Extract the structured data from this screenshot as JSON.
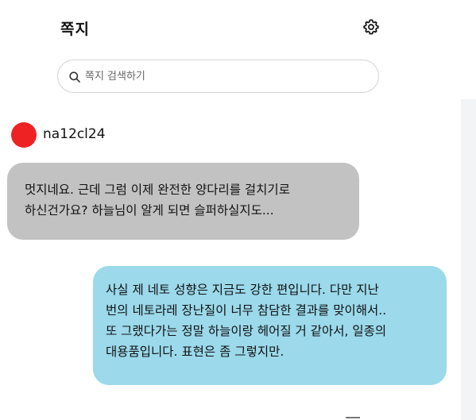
{
  "header": {
    "title": "쪽지",
    "settings_icon": "gear-icon"
  },
  "search": {
    "icon": "search-icon",
    "placeholder": "쪽지 검색하기"
  },
  "conversation": {
    "user": {
      "name": "na12cl24",
      "avatar_color": "#ee2222"
    },
    "messages": [
      {
        "direction": "received",
        "bubble_color": "#c2c2c2",
        "lines": [
          "멋지네요. 근데 그럼 이제 완전한 양다리를 걸치기로",
          "하신건가요? 하늘님이 알게 되면 슬퍼하실지도..."
        ]
      },
      {
        "direction": "sent",
        "bubble_color": "#9bd9eb",
        "lines": [
          "사실 제 네토 성향은 지금도 강한 편입니다. 다만 지난",
          "번의 네토라레 장난질이 너무 참담한 결과를 맞이해서..",
          "또 그랬다가는 정말 하늘이랑 헤어질 거 같아서, 일종의",
          "대용품입니다. 표현은 좀 그렇지만."
        ]
      }
    ]
  }
}
